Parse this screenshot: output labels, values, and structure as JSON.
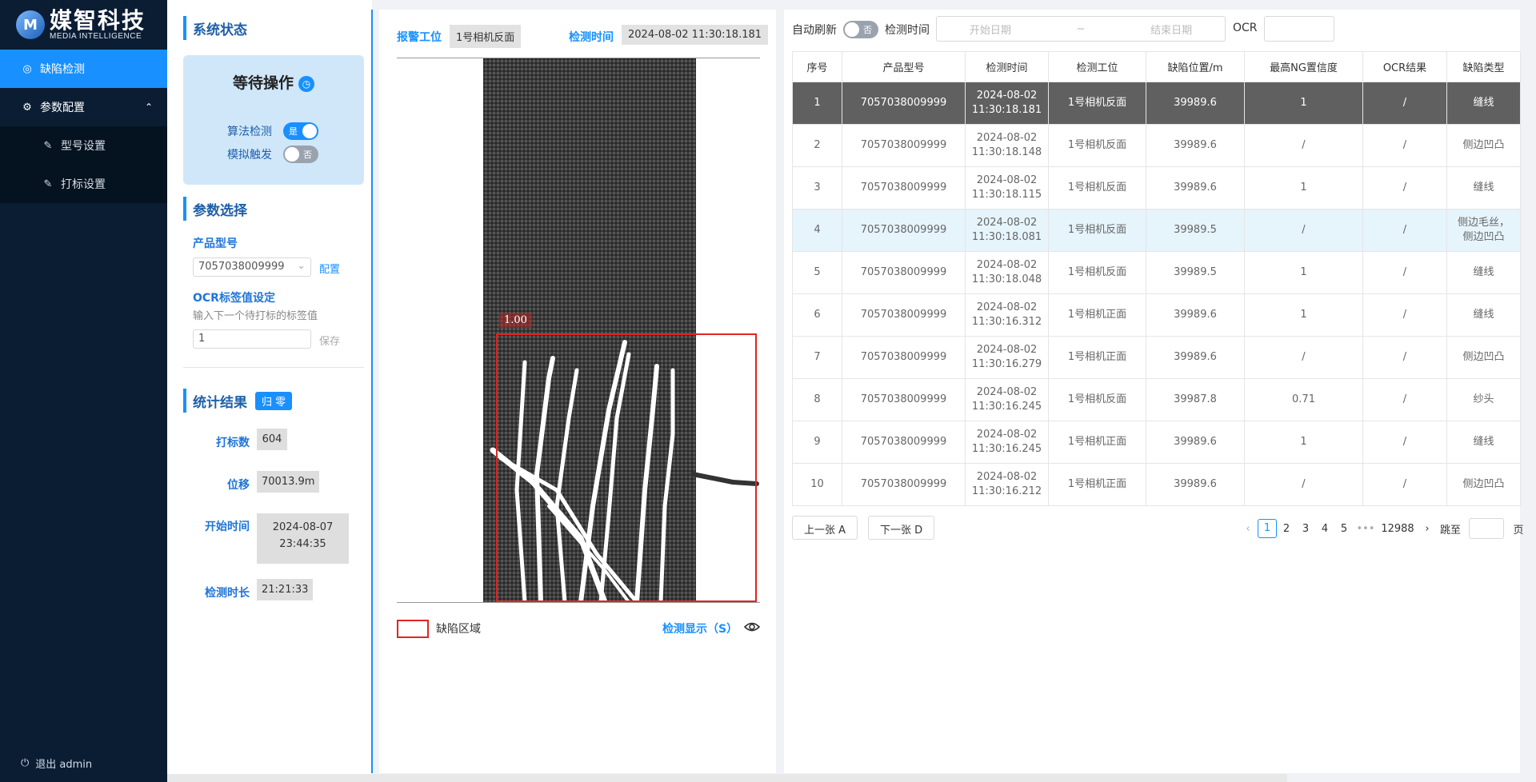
{
  "brand": {
    "cn": "媒智科技",
    "en": "MEDIA INTELLIGENCE",
    "mark": "M"
  },
  "sidebar": {
    "items": [
      {
        "label": "缺陷检测",
        "icon": "camera-icon",
        "active": true
      },
      {
        "label": "参数配置",
        "icon": "gear-icon",
        "expanded": true
      }
    ],
    "subitems": [
      {
        "label": "型号设置",
        "icon": "edit-icon"
      },
      {
        "label": "打标设置",
        "icon": "edit-icon"
      }
    ],
    "logout": "退出 admin"
  },
  "status": {
    "title": "系统状态",
    "state": "等待操作",
    "algo_label": "算法检测",
    "algo_value": "是",
    "sim_label": "模拟触发",
    "sim_value": "否"
  },
  "params": {
    "title": "参数选择",
    "product_label": "产品型号",
    "product_value": "7057038009999",
    "config_link": "配置",
    "ocr_label": "OCR标签值设定",
    "ocr_hint": "输入下一个待打标的标签值",
    "ocr_value": "1",
    "save_link": "保存"
  },
  "stats": {
    "title": "统计结果",
    "reset_button": "归 零",
    "mark_count_label": "打标数",
    "mark_count": "604",
    "offset_label": "位移",
    "offset": "70013.9m",
    "start_label": "开始时间",
    "start_date": "2024-08-07",
    "start_time": "23:44:35",
    "duration_label": "检测时长",
    "duration": "21:21:33"
  },
  "image_panel": {
    "station_label": "报警工位",
    "station_value": "1号相机反面",
    "time_label": "检测时间",
    "time_value": "2024-08-02 11:30:18.181",
    "defect_score": "1.00",
    "legend_label": "缺陷区域",
    "show_link": "检测显示（S）"
  },
  "filters": {
    "auto_refresh_label": "自动刷新",
    "auto_refresh_value": "否",
    "time_label": "检测时间",
    "start_placeholder": "开始日期",
    "range_sep": "~",
    "end_placeholder": "结束日期",
    "ocr_label": "OCR"
  },
  "table": {
    "columns": [
      "序号",
      "产品型号",
      "检测时间",
      "检测工位",
      "缺陷位置/m",
      "最高NG置信度",
      "OCR结果",
      "缺陷类型"
    ],
    "rows": [
      [
        "1",
        "7057038009999",
        "2024-08-02",
        "11:30:18.181",
        "1号相机反面",
        "39989.6",
        "1",
        "/",
        "缝线",
        ""
      ],
      [
        "2",
        "7057038009999",
        "2024-08-02",
        "11:30:18.148",
        "1号相机反面",
        "39989.6",
        "/",
        "/",
        "侧边凹凸",
        ""
      ],
      [
        "3",
        "7057038009999",
        "2024-08-02",
        "11:30:18.115",
        "1号相机反面",
        "39989.6",
        "1",
        "/",
        "缝线",
        ""
      ],
      [
        "4",
        "7057038009999",
        "2024-08-02",
        "11:30:18.081",
        "1号相机反面",
        "39989.5",
        "/",
        "/",
        "侧边毛丝，",
        "侧边凹凸"
      ],
      [
        "5",
        "7057038009999",
        "2024-08-02",
        "11:30:18.048",
        "1号相机反面",
        "39989.5",
        "1",
        "/",
        "缝线",
        ""
      ],
      [
        "6",
        "7057038009999",
        "2024-08-02",
        "11:30:16.312",
        "1号相机正面",
        "39989.6",
        "1",
        "/",
        "缝线",
        ""
      ],
      [
        "7",
        "7057038009999",
        "2024-08-02",
        "11:30:16.279",
        "1号相机正面",
        "39989.6",
        "/",
        "/",
        "侧边凹凸",
        ""
      ],
      [
        "8",
        "7057038009999",
        "2024-08-02",
        "11:30:16.245",
        "1号相机反面",
        "39987.8",
        "0.71",
        "/",
        "纱头",
        ""
      ],
      [
        "9",
        "7057038009999",
        "2024-08-02",
        "11:30:16.245",
        "1号相机正面",
        "39989.6",
        "1",
        "/",
        "缝线",
        ""
      ],
      [
        "10",
        "7057038009999",
        "2024-08-02",
        "11:30:16.212",
        "1号相机正面",
        "39989.6",
        "/",
        "/",
        "侧边凹凸",
        ""
      ]
    ]
  },
  "pagination": {
    "prev_button": "上一张 A",
    "next_button": "下一张 D",
    "pages": [
      "1",
      "2",
      "3",
      "4",
      "5"
    ],
    "current": "1",
    "ellipsis": "•••",
    "last": "12988",
    "jump_label": "跳至",
    "page_suffix": "页"
  },
  "colors": {
    "accent": "#1890ff",
    "sidebar": "#0a1d33",
    "defect": "#e02424",
    "selected_row": "#606060"
  }
}
